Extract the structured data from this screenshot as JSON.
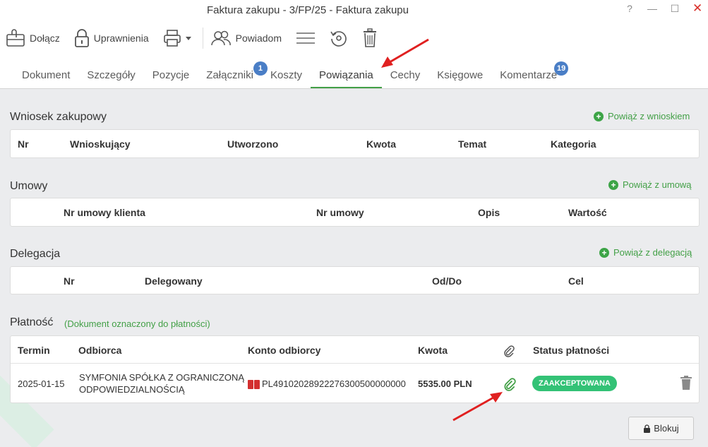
{
  "window": {
    "title": "Faktura zakupu - 3/FP/25 - Faktura zakupu",
    "help": "?",
    "minimize": "—",
    "maximize": "☐",
    "close": "✕"
  },
  "toolbar": {
    "attach_label": "Dołącz",
    "permissions_label": "Uprawnienia",
    "notify_label": "Powiadom"
  },
  "tabs": [
    {
      "label": "Dokument"
    },
    {
      "label": "Szczegóły"
    },
    {
      "label": "Pozycje"
    },
    {
      "label": "Załączniki",
      "badge": "1"
    },
    {
      "label": "Koszty"
    },
    {
      "label": "Powiązania"
    },
    {
      "label": "Cechy"
    },
    {
      "label": "Księgowe"
    },
    {
      "label": "Komentarze",
      "badge": "19"
    }
  ],
  "sections": {
    "wniosek": {
      "title": "Wniosek zakupowy",
      "add_label": "Powiąż z wnioskiem",
      "columns": [
        "Nr",
        "Wnioskujący",
        "Utworzono",
        "Kwota",
        "Temat",
        "Kategoria"
      ]
    },
    "umowy": {
      "title": "Umowy",
      "add_label": "Powiąż z umową",
      "columns": [
        "Nr umowy klienta",
        "Nr umowy",
        "Opis",
        "Wartość"
      ]
    },
    "delegacja": {
      "title": "Delegacja",
      "add_label": "Powiąż z delegacją",
      "columns": [
        "Nr",
        "Delegowany",
        "Od/Do",
        "Cel"
      ]
    },
    "platnosc": {
      "title": "Płatność",
      "note": "(Dokument oznaczony do płatności)",
      "columns": [
        "Termin",
        "Odbiorca",
        "Konto odbiorcy",
        "Kwota",
        "Status płatności"
      ],
      "row": {
        "termin": "2025-01-15",
        "odbiorca_line1": "SYMFONIA SPÓŁKA Z OGRANICZONĄ",
        "odbiorca_line2": "ODPOWIEDZIALNOŚCIĄ",
        "konto": "PL49102028922276300500000000",
        "kwota": "5535.00 PLN",
        "status": "ZAAKCEPTOWANA"
      }
    }
  },
  "footer": {
    "lock_label": "Blokuj"
  },
  "colors": {
    "accent": "#43a047",
    "status_green": "#33c276",
    "badge_blue": "#4a7ec6",
    "arrow_red": "#e02020"
  }
}
